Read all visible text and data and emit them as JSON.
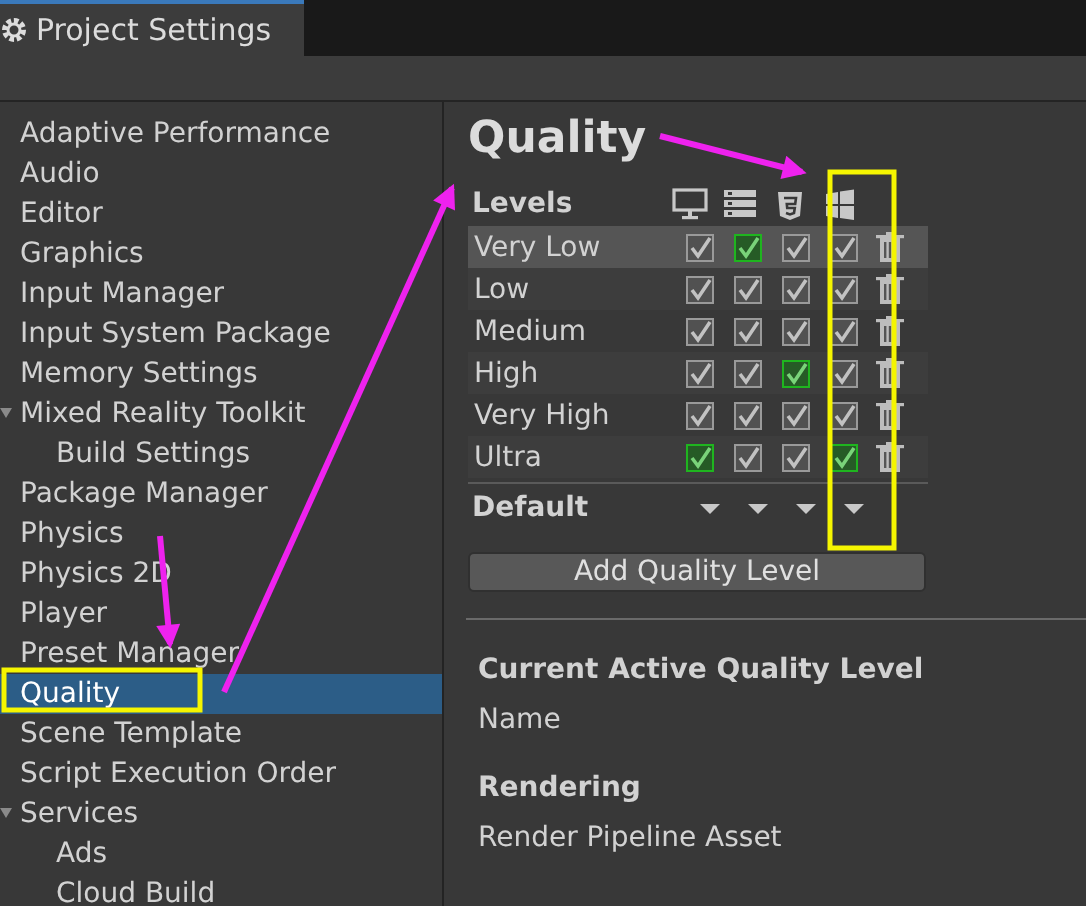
{
  "window": {
    "title": "Project Settings"
  },
  "sidebar": {
    "items": [
      {
        "label": "Adaptive Performance",
        "selected": false
      },
      {
        "label": "Audio",
        "selected": false
      },
      {
        "label": "Editor",
        "selected": false
      },
      {
        "label": "Graphics",
        "selected": false
      },
      {
        "label": "Input Manager",
        "selected": false
      },
      {
        "label": "Input System Package",
        "selected": false
      },
      {
        "label": "Memory Settings",
        "selected": false
      },
      {
        "label": "Mixed Reality Toolkit",
        "selected": false,
        "expanded": true,
        "children": [
          {
            "label": "Build Settings",
            "selected": false
          }
        ]
      },
      {
        "label": "Package Manager",
        "selected": false
      },
      {
        "label": "Physics",
        "selected": false
      },
      {
        "label": "Physics 2D",
        "selected": false
      },
      {
        "label": "Player",
        "selected": false
      },
      {
        "label": "Preset Manager",
        "selected": false
      },
      {
        "label": "Quality",
        "selected": true
      },
      {
        "label": "Scene Template",
        "selected": false
      },
      {
        "label": "Script Execution Order",
        "selected": false
      },
      {
        "label": "Services",
        "selected": false,
        "expanded": true,
        "children": [
          {
            "label": "Ads",
            "selected": false
          },
          {
            "label": "Cloud Build",
            "selected": false
          }
        ]
      }
    ]
  },
  "page": {
    "title": "Quality",
    "levels_header": "Levels",
    "platforms": [
      {
        "kind": "desktop"
      },
      {
        "kind": "server"
      },
      {
        "kind": "html5"
      },
      {
        "kind": "windows"
      }
    ],
    "levels": [
      {
        "name": "Very Low",
        "selected": true,
        "platforms": [
          {
            "checked": true,
            "color": "#9a9a9a"
          },
          {
            "checked": true,
            "color": "#1fb51f"
          },
          {
            "checked": true,
            "color": "#9a9a9a"
          },
          {
            "checked": true,
            "color": "#9a9a9a"
          }
        ]
      },
      {
        "name": "Low",
        "selected": false,
        "platforms": [
          {
            "checked": true,
            "color": "#9a9a9a"
          },
          {
            "checked": true,
            "color": "#9a9a9a"
          },
          {
            "checked": true,
            "color": "#9a9a9a"
          },
          {
            "checked": true,
            "color": "#9a9a9a"
          }
        ]
      },
      {
        "name": "Medium",
        "selected": false,
        "platforms": [
          {
            "checked": true,
            "color": "#9a9a9a"
          },
          {
            "checked": true,
            "color": "#9a9a9a"
          },
          {
            "checked": true,
            "color": "#9a9a9a"
          },
          {
            "checked": true,
            "color": "#9a9a9a"
          }
        ]
      },
      {
        "name": "High",
        "selected": false,
        "platforms": [
          {
            "checked": true,
            "color": "#9a9a9a"
          },
          {
            "checked": true,
            "color": "#9a9a9a"
          },
          {
            "checked": true,
            "color": "#1fb51f"
          },
          {
            "checked": true,
            "color": "#9a9a9a"
          }
        ]
      },
      {
        "name": "Very High",
        "selected": false,
        "platforms": [
          {
            "checked": true,
            "color": "#9a9a9a"
          },
          {
            "checked": true,
            "color": "#9a9a9a"
          },
          {
            "checked": true,
            "color": "#9a9a9a"
          },
          {
            "checked": true,
            "color": "#9a9a9a"
          }
        ]
      },
      {
        "name": "Ultra",
        "selected": false,
        "platforms": [
          {
            "checked": true,
            "color": "#1fb51f"
          },
          {
            "checked": true,
            "color": "#9a9a9a"
          },
          {
            "checked": true,
            "color": "#9a9a9a"
          },
          {
            "checked": true,
            "color": "#1fb51f"
          }
        ]
      }
    ],
    "default_label": "Default",
    "add_button": "Add Quality Level",
    "sections": [
      {
        "heading": "Current Active Quality Level",
        "fields": [
          "Name"
        ]
      },
      {
        "heading": "Rendering",
        "fields": [
          "Render Pipeline Asset"
        ]
      }
    ]
  }
}
